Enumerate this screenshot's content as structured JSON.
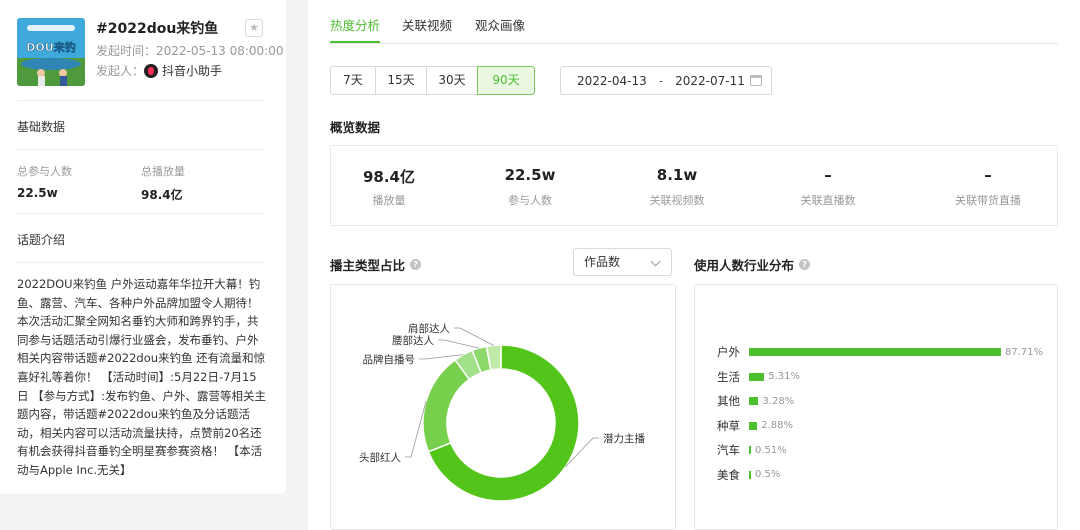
{
  "topic": {
    "title": "#2022dou来钓鱼",
    "start_time_label": "发起时间：",
    "start_time": "2022-05-13 08:00:00",
    "initiator_label": "发起人：",
    "initiator": "抖音小助手",
    "cover_badge": "DOU来钓鱼"
  },
  "basic": {
    "title": "基础数据",
    "participants_label": "总参与人数",
    "participants_value": "22.5w",
    "plays_label": "总播放量",
    "plays_value": "98.4亿"
  },
  "intro": {
    "title": "话题介绍",
    "text": "2022DOU来钓鱼 户外运动嘉年华拉开大幕！钓鱼、露营、汽车、各种户外品牌加盟令人期待！本次活动汇聚全网知名垂钓大师和跨界钓手，共同参与话题活动引爆行业盛会，发布垂钓、户外相关内容带话题#2022dou来钓鱼 还有流量和惊喜好礼等着你！ 【活动时间】:5月22日-7月15日 【参与方式】:发布钓鱼、户外、露营等相关主题内容，带话题#2022dou来钓鱼及分话题活动，相关内容可以活动流量扶持，点赞前20名还有机会获得抖音垂钓全明星赛参赛资格！ 【本活动与Apple Inc.无关】"
  },
  "tabs": [
    "热度分析",
    "关联视频",
    "观众画像"
  ],
  "ranges": [
    "7天",
    "15天",
    "30天",
    "90天"
  ],
  "date_range": {
    "start": "2022-04-13",
    "separator": "-",
    "end": "2022-07-11"
  },
  "overview": {
    "title": "概览数据",
    "items": [
      {
        "value": "98.4亿",
        "label": "播放量"
      },
      {
        "value": "22.5w",
        "label": "参与人数"
      },
      {
        "value": "8.1w",
        "label": "关联视频数"
      },
      {
        "value": "–",
        "label": "关联直播数"
      },
      {
        "value": "–",
        "label": "关联带货直播"
      }
    ]
  },
  "creator_types": {
    "title": "播主类型占比",
    "select_value": "作品数",
    "slices": [
      {
        "name": "潜力主播",
        "value": 69,
        "color": "#52c41a"
      },
      {
        "name": "头部红人",
        "value": 21,
        "color": "#76d04b"
      },
      {
        "name": "品牌自播号",
        "value": 4,
        "color": "#a3e08a"
      },
      {
        "name": "腰部达人",
        "value": 3,
        "color": "#8bd96a"
      },
      {
        "name": "肩部达人",
        "value": 3,
        "color": "#c0eaa9"
      }
    ]
  },
  "industry": {
    "title": "使用人数行业分布",
    "rows": [
      {
        "label": "户外",
        "value": 87.71,
        "pct": "87.71%"
      },
      {
        "label": "生活",
        "value": 5.31,
        "pct": "5.31%"
      },
      {
        "label": "其他",
        "value": 3.28,
        "pct": "3.28%"
      },
      {
        "label": "种草",
        "value": 2.88,
        "pct": "2.88%"
      },
      {
        "label": "汽车",
        "value": 0.51,
        "pct": "0.51%"
      },
      {
        "label": "美食",
        "value": 0.5,
        "pct": "0.5%"
      }
    ]
  }
}
